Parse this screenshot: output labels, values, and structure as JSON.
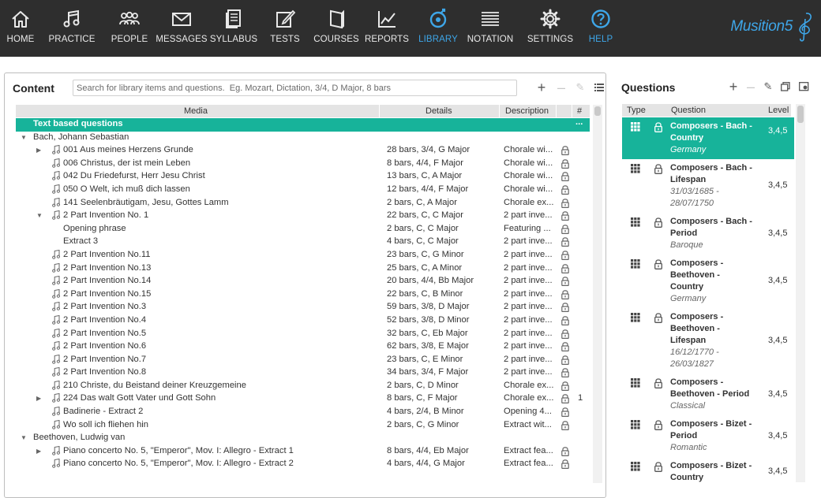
{
  "nav": [
    {
      "label": "HOME",
      "icon": "home-icon"
    },
    {
      "label": "PRACTICE",
      "icon": "music-note-icon"
    },
    {
      "label": "PEOPLE",
      "icon": "people-icon"
    },
    {
      "label": "MESSAGES",
      "icon": "envelope-icon"
    },
    {
      "label": "SYLLABUS",
      "icon": "syllabus-icon"
    },
    {
      "label": "TESTS",
      "icon": "pencil-square-icon"
    },
    {
      "label": "COURSES",
      "icon": "book-icon"
    },
    {
      "label": "REPORTS",
      "icon": "chart-icon"
    },
    {
      "label": "LIBRARY",
      "icon": "library-icon"
    },
    {
      "label": "NOTATION",
      "icon": "staff-icon"
    },
    {
      "label": "SETTINGS",
      "icon": "gear-icon"
    },
    {
      "label": "HELP",
      "icon": "help-icon"
    }
  ],
  "active_nav": "LIBRARY",
  "logo": "Musition5",
  "colors": {
    "accent": "#3ea6e8",
    "teal": "#17b39a",
    "topbar": "#2e2e2e"
  },
  "content": {
    "title": "Content",
    "search_placeholder": "Search for library items and questions.  Eg. Mozart, Dictation, 3/4, D Major, 8 bars",
    "columns": {
      "media": "Media",
      "details": "Details",
      "description": "Description",
      "num": "#"
    },
    "group_bar": {
      "label": "Text based questions",
      "more": "..."
    },
    "rows": [
      {
        "indent": 0,
        "tri": "down",
        "note": false,
        "media": "Bach, Johann Sebastian",
        "details": "",
        "desc": "",
        "lock": false,
        "num": ""
      },
      {
        "indent": 1,
        "tri": "right",
        "note": true,
        "media": "001 Aus meines Herzens Grunde",
        "details": "28  bars, 3/4, G Major",
        "desc": "Chorale wi...",
        "lock": true,
        "num": ""
      },
      {
        "indent": 1,
        "tri": "",
        "note": true,
        "media": "006 Christus, der ist mein Leben",
        "details": "8  bars, 4/4, F Major",
        "desc": "Chorale wi...",
        "lock": true,
        "num": ""
      },
      {
        "indent": 1,
        "tri": "",
        "note": true,
        "media": "042 Du Friedefurst, Herr Jesu Christ",
        "details": "13  bars, C, A Major",
        "desc": "Chorale wi...",
        "lock": true,
        "num": ""
      },
      {
        "indent": 1,
        "tri": "",
        "note": true,
        "media": "050 O Welt, ich muß dich lassen",
        "details": "12  bars, 4/4, F Major",
        "desc": "Chorale wi...",
        "lock": true,
        "num": ""
      },
      {
        "indent": 1,
        "tri": "",
        "note": true,
        "media": "141 Seelenbräutigam, Jesu, Gottes Lamm",
        "details": "2  bars, C, A Major",
        "desc": "Chorale ex...",
        "lock": true,
        "num": ""
      },
      {
        "indent": 1,
        "tri": "down",
        "note": true,
        "media": "2 Part Invention No. 1",
        "details": "22  bars, C, C Major",
        "desc": "2 part inve...",
        "lock": true,
        "num": ""
      },
      {
        "indent": 2,
        "tri": "",
        "note": false,
        "media": "Opening phrase",
        "details": "2  bars, C, C Major",
        "desc": "Featuring ...",
        "lock": true,
        "num": ""
      },
      {
        "indent": 2,
        "tri": "",
        "note": false,
        "media": "Extract 3",
        "details": "4  bars, C, C Major",
        "desc": "2 part inve...",
        "lock": true,
        "num": ""
      },
      {
        "indent": 1,
        "tri": "",
        "note": true,
        "media": "2 Part Invention No.11",
        "details": "23  bars, C, G Minor",
        "desc": "2 part inve...",
        "lock": true,
        "num": ""
      },
      {
        "indent": 1,
        "tri": "",
        "note": true,
        "media": "2 Part Invention No.13",
        "details": "25  bars, C, A Minor",
        "desc": "2 part inve...",
        "lock": true,
        "num": ""
      },
      {
        "indent": 1,
        "tri": "",
        "note": true,
        "media": "2 Part Invention No.14",
        "details": "20  bars, 4/4, Bb Major",
        "desc": "2 part inve...",
        "lock": true,
        "num": ""
      },
      {
        "indent": 1,
        "tri": "",
        "note": true,
        "media": "2 Part Invention No.15",
        "details": "22  bars, C, B Minor",
        "desc": "2 part inve...",
        "lock": true,
        "num": ""
      },
      {
        "indent": 1,
        "tri": "",
        "note": true,
        "media": "2 Part Invention No.3",
        "details": "59  bars, 3/8, D Major",
        "desc": "2 part inve...",
        "lock": true,
        "num": ""
      },
      {
        "indent": 1,
        "tri": "",
        "note": true,
        "media": "2 Part Invention No.4",
        "details": "52  bars, 3/8, D Minor",
        "desc": "2 part inve...",
        "lock": true,
        "num": ""
      },
      {
        "indent": 1,
        "tri": "",
        "note": true,
        "media": "2 Part Invention No.5",
        "details": "32  bars, C, Eb Major",
        "desc": "2 part inve...",
        "lock": true,
        "num": ""
      },
      {
        "indent": 1,
        "tri": "",
        "note": true,
        "media": "2 Part Invention No.6",
        "details": "62  bars, 3/8, E Major",
        "desc": "2 part inve...",
        "lock": true,
        "num": ""
      },
      {
        "indent": 1,
        "tri": "",
        "note": true,
        "media": "2 Part Invention No.7",
        "details": "23  bars, C, E Minor",
        "desc": "2 part inve...",
        "lock": true,
        "num": ""
      },
      {
        "indent": 1,
        "tri": "",
        "note": true,
        "media": "2 Part Invention No.8",
        "details": "34  bars, 3/4, F Major",
        "desc": "2 part inve...",
        "lock": true,
        "num": ""
      },
      {
        "indent": 1,
        "tri": "",
        "note": true,
        "media": "210 Christe, du Beistand deiner Kreuzgemeine",
        "details": "2  bars, C, D Minor",
        "desc": "Chorale ex...",
        "lock": true,
        "num": ""
      },
      {
        "indent": 1,
        "tri": "right",
        "note": true,
        "media": "224 Das walt Gott Vater und Gott Sohn",
        "details": "8  bars, C, F Major",
        "desc": "Chorale ex...",
        "lock": true,
        "num": "1"
      },
      {
        "indent": 1,
        "tri": "",
        "note": true,
        "media": "Badinerie - Extract 2",
        "details": "4  bars, 2/4, B Minor",
        "desc": "Opening 4...",
        "lock": true,
        "num": ""
      },
      {
        "indent": 1,
        "tri": "",
        "note": true,
        "media": "Wo soll ich fliehen hin",
        "details": "2  bars, C, G Minor",
        "desc": "Extract wit...",
        "lock": true,
        "num": ""
      },
      {
        "indent": 0,
        "tri": "down",
        "note": false,
        "media": "Beethoven, Ludwig van",
        "details": "",
        "desc": "",
        "lock": false,
        "num": ""
      },
      {
        "indent": 1,
        "tri": "right",
        "note": true,
        "media": "Piano concerto No. 5, \"Emperor\", Mov. I: Allegro - Extract 1",
        "details": "8  bars, 4/4, Eb Major",
        "desc": "Extract fea...",
        "lock": true,
        "num": ""
      },
      {
        "indent": 1,
        "tri": "",
        "note": true,
        "media": "Piano concerto No. 5, \"Emperor\", Mov. I: Allegro - Extract 2",
        "details": "4  bars, 4/4, G Major",
        "desc": "Extract fea...",
        "lock": true,
        "num": ""
      }
    ]
  },
  "questions": {
    "title": "Questions",
    "columns": {
      "type": "Type",
      "question": "Question",
      "level": "Level"
    },
    "rows": [
      {
        "lines": [
          "Composers - Bach -",
          "Country"
        ],
        "sub": [
          "Germany"
        ],
        "level": "3,4,5",
        "selected": true
      },
      {
        "lines": [
          "Composers - Bach -",
          "Lifespan"
        ],
        "sub": [
          "31/03/1685 -",
          "28/07/1750"
        ],
        "level": "3,4,5",
        "selected": false
      },
      {
        "lines": [
          "Composers - Bach -",
          "Period"
        ],
        "sub": [
          "Baroque"
        ],
        "level": "3,4,5",
        "selected": false
      },
      {
        "lines": [
          "Composers -",
          "Beethoven -",
          "Country"
        ],
        "sub": [
          "Germany"
        ],
        "level": "3,4,5",
        "selected": false
      },
      {
        "lines": [
          "Composers -",
          "Beethoven -",
          "Lifespan"
        ],
        "sub": [
          "16/12/1770 -",
          "26/03/1827"
        ],
        "level": "3,4,5",
        "selected": false
      },
      {
        "lines": [
          "Composers -",
          "Beethoven - Period"
        ],
        "sub": [
          "Classical"
        ],
        "level": "3,4,5",
        "selected": false
      },
      {
        "lines": [
          "Composers - Bizet -",
          "Period"
        ],
        "sub": [
          "Romantic"
        ],
        "level": "3,4,5",
        "selected": false
      },
      {
        "lines": [
          "Composers - Bizet -",
          "Country"
        ],
        "sub": [],
        "level": "3,4,5",
        "selected": false
      }
    ]
  }
}
